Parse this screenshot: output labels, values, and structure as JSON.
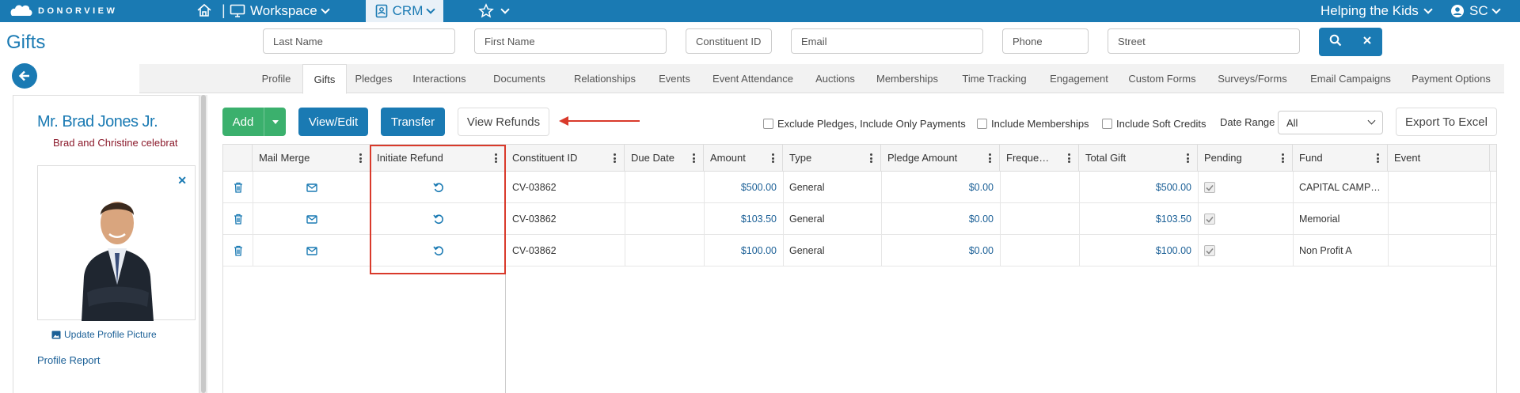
{
  "topbar": {
    "logo_text": "DONORVIEW",
    "separator": "|",
    "workspace_label": "Workspace",
    "crm_label": "CRM",
    "org_name": "Helping the Kids",
    "user_initials": "SC"
  },
  "page": {
    "title": "Gifts"
  },
  "search": {
    "last_name": "Last Name",
    "first_name": "First Name",
    "constituent_id": "Constituent ID",
    "email": "Email",
    "phone": "Phone",
    "street": "Street"
  },
  "tabs": [
    "Profile",
    "Gifts",
    "Pledges",
    "Interactions",
    "Documents",
    "Relationships",
    "Events",
    "Event Attendance",
    "Auctions",
    "Memberships",
    "Time Tracking",
    "Engagement",
    "Custom Forms",
    "Surveys/Forms",
    "Email Campaigns",
    "Payment Options"
  ],
  "active_tab": "Gifts",
  "profile": {
    "name": "Mr. Brad Jones Jr.",
    "subtitle": "Brad and Christine celebrat",
    "update_picture": "Update Profile Picture",
    "profile_report": "Profile Report"
  },
  "toolbar": {
    "add": "Add",
    "view_edit": "View/Edit",
    "transfer": "Transfer",
    "view_refunds": "View Refunds",
    "exclude_pledges": "Exclude Pledges, Include Only Payments",
    "include_memberships": "Include Memberships",
    "include_soft_credits": "Include Soft Credits",
    "date_range_label": "Date Range",
    "date_range_value": "All",
    "export": "Export To Excel"
  },
  "table": {
    "headers": {
      "mail_merge": "Mail Merge",
      "initiate_refund": "Initiate Refund",
      "constituent_id": "Constituent ID",
      "due_date": "Due Date",
      "amount": "Amount",
      "type": "Type",
      "pledge_amount": "Pledge Amount",
      "frequency": "Freque…",
      "total_gift": "Total Gift",
      "pending": "Pending",
      "fund": "Fund",
      "event": "Event"
    },
    "rows": [
      {
        "constituent_id": "CV-03862",
        "due_date": "",
        "amount": "$500.00",
        "type": "General",
        "pledge_amount": "$0.00",
        "frequency": "",
        "total_gift": "$500.00",
        "pending": true,
        "fund": "CAPITAL CAMP…",
        "event": ""
      },
      {
        "constituent_id": "CV-03862",
        "due_date": "",
        "amount": "$103.50",
        "type": "General",
        "pledge_amount": "$0.00",
        "frequency": "",
        "total_gift": "$103.50",
        "pending": true,
        "fund": "Memorial",
        "event": ""
      },
      {
        "constituent_id": "CV-03862",
        "due_date": "",
        "amount": "$100.00",
        "type": "General",
        "pledge_amount": "$0.00",
        "frequency": "",
        "total_gift": "$100.00",
        "pending": true,
        "fund": "Non Profit A",
        "event": ""
      }
    ]
  },
  "colors": {
    "brand": "#1a7ab3",
    "add_green": "#3bb06d",
    "highlight_red": "#d93a2b"
  }
}
